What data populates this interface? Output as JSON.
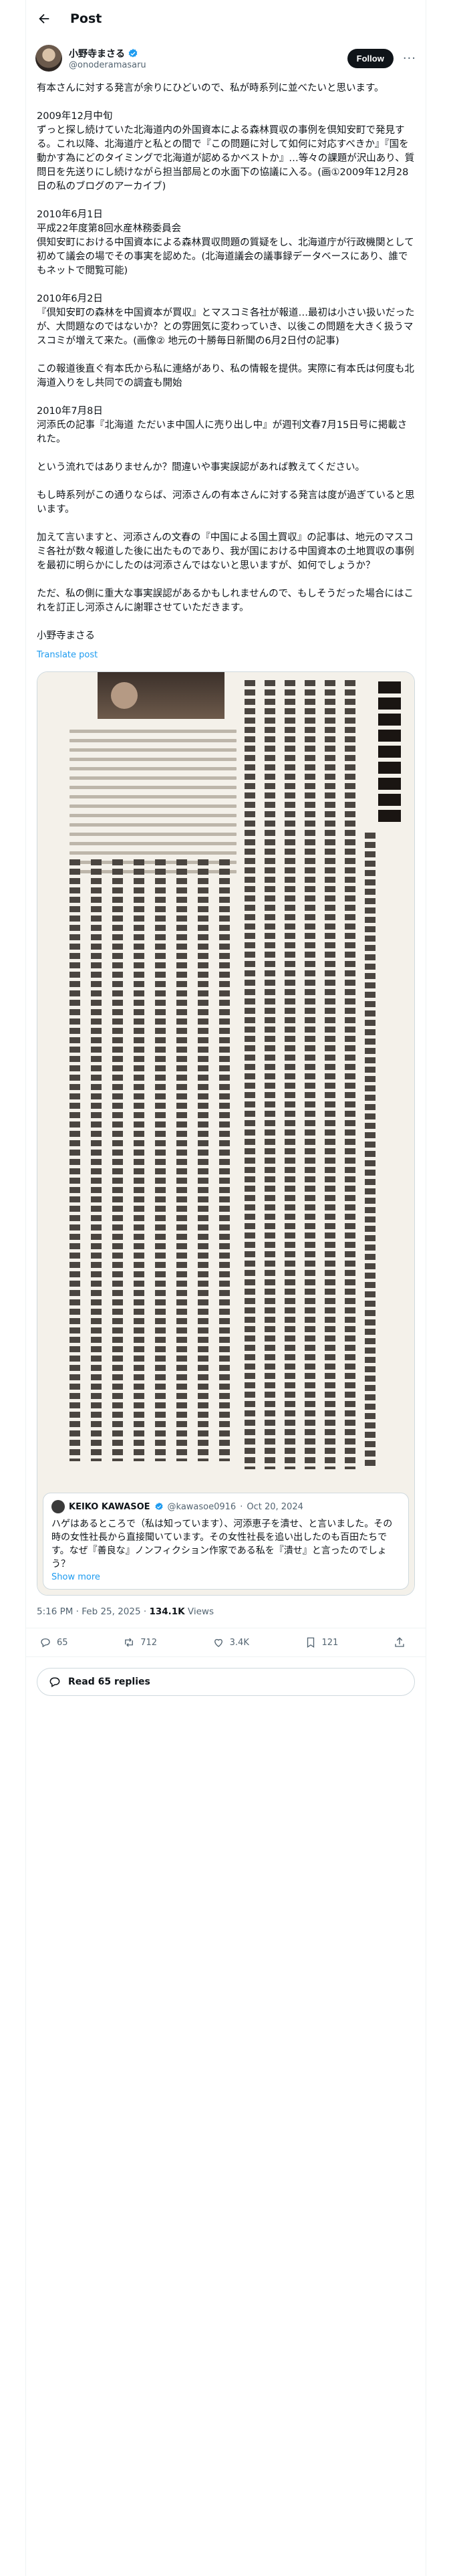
{
  "header": {
    "title": "Post"
  },
  "author": {
    "display_name": "小野寺まさる",
    "handle": "@onoderamasaru",
    "follow_label": "Follow",
    "more_label": "···"
  },
  "body": {
    "paragraphs": [
      "有本さんに対する発言が余りにひどいので、私が時系列に並べたいと思います。",
      "2009年12月中旬\nずっと探し続けていた北海道内の外国資本による森林買収の事例を倶知安町で発見する。これ以降、北海道庁と私との間で『この問題に対して如何に対応すべきか』『国を動かす為にどのタイミングで北海道が認めるかベストか』…等々の課題が沢山あり、質問日を先送りにし続けながら担当部局との水面下の協議に入る。(画①2009年12月28日の私のブログのアーカイブ)",
      "2010年6月1日\n平成22年度第8回水産林務委員会\n倶知安町における中国資本による森林買収問題の質疑をし、北海道庁が行政機関として初めて議会の場でその事実を認めた。(北海道議会の議事録データベースにあり、誰でもネットで閲覧可能)",
      "2010年6月2日\n『倶知安町の森林を中国資本が買収』とマスコミ各社が報道…最初は小さい扱いだったが、大問題なのではないか？との雰囲気に変わっていき、以後この問題を大きく扱うマスコミが増えて来た。(画像② 地元の十勝毎日新聞の6月2日付の記事)",
      "この報道後直ぐ有本氏から私に連絡があり、私の情報を提供。実際に有本氏は何度も北海道入りをし共同での調査も開始",
      "2010年7月8日\n河添氏の記事『北海道 ただいま中国人に売り出し中』が週刊文春7月15日号に掲載された。",
      "という流れではありませんか？間違いや事実誤認があれば教えてください。",
      "もし時系列がこの通りならば、河添さんの有本さんに対する発言は度が過ぎていると思います。",
      "加えて言いますと、河添さんの文春の『中国による国土買収』の記事は、地元のマスコミ各社が数々報道した後に出たものであり、我が国における中国資本の土地買収の事例を最初に明らかにしたのは河添さんではないと思いますが、如何でしょうか？",
      "ただ、私の側に重大な事実誤認があるかもしれませんので、もしそうだった場合にはこれを訂正し河添さんに謝罪させていただきます。",
      "小野寺まさる"
    ],
    "translate_label": "Translate post"
  },
  "quote": {
    "name": "KEIKO KAWASOE",
    "handle": "@kawasoe0916",
    "date": "Oct 20, 2024",
    "text": "ハゲはあるところで（私は知っています）、河添恵子を潰せ、と言いました。その時の女性社長から直接聞いています。その女性社長を追い出したのも百田たちです。なぜ『善良な』ノンフィクション作家である私を『潰せ』と言ったのでしょう？",
    "show_more": "Show more"
  },
  "meta": {
    "time": "5:16 PM · Feb 25, 2025 · ",
    "views_count": "134.1K",
    "views_label": " Views"
  },
  "actions": {
    "replies": "65",
    "reposts": "712",
    "likes": "3.4K",
    "bookmarks": "121"
  },
  "read_replies": "Read 65 replies",
  "colors": {
    "accent": "#1d9bf0",
    "verified": "#1d9bf0",
    "text": "#0f1419",
    "muted": "#536471"
  }
}
